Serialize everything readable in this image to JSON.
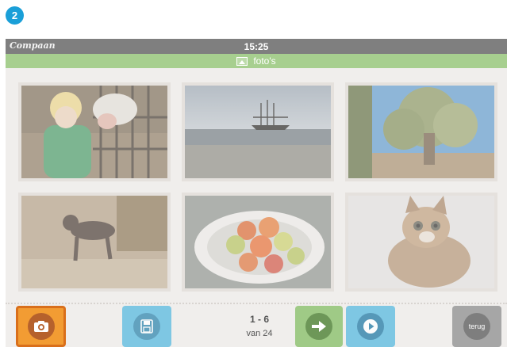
{
  "step_badge": "2",
  "status_bar": {
    "brand": "Compaan",
    "time": "15:25"
  },
  "title_bar": {
    "icon": "photo-icon",
    "title": "foto's"
  },
  "photos": [
    {
      "subject": "child-with-cow",
      "icon": "photo-thumbnail"
    },
    {
      "subject": "sailing-ship-at-sea",
      "icon": "photo-thumbnail"
    },
    {
      "subject": "olive-tree",
      "icon": "photo-thumbnail"
    },
    {
      "subject": "brown-dog",
      "icon": "photo-thumbnail"
    },
    {
      "subject": "bowl-of-fruit",
      "icon": "photo-thumbnail"
    },
    {
      "subject": "kitten",
      "icon": "photo-thumbnail"
    }
  ],
  "toolbar": {
    "camera_icon": "camera-icon",
    "save_icon": "save-icon",
    "next_icon": "arrow-right-icon",
    "play_icon": "play-icon",
    "back_label": "terug",
    "page_range": "1 - 6",
    "page_total": "van 24"
  },
  "colors": {
    "badge": "#1a9fd8",
    "status_bar": "#7f7f7f",
    "title_bar": "#a7cf8f",
    "camera_button": "#f29c33",
    "blue_button": "#6bc1e2",
    "green_button": "#9fca86",
    "grey_button": "#a6a6a6"
  }
}
